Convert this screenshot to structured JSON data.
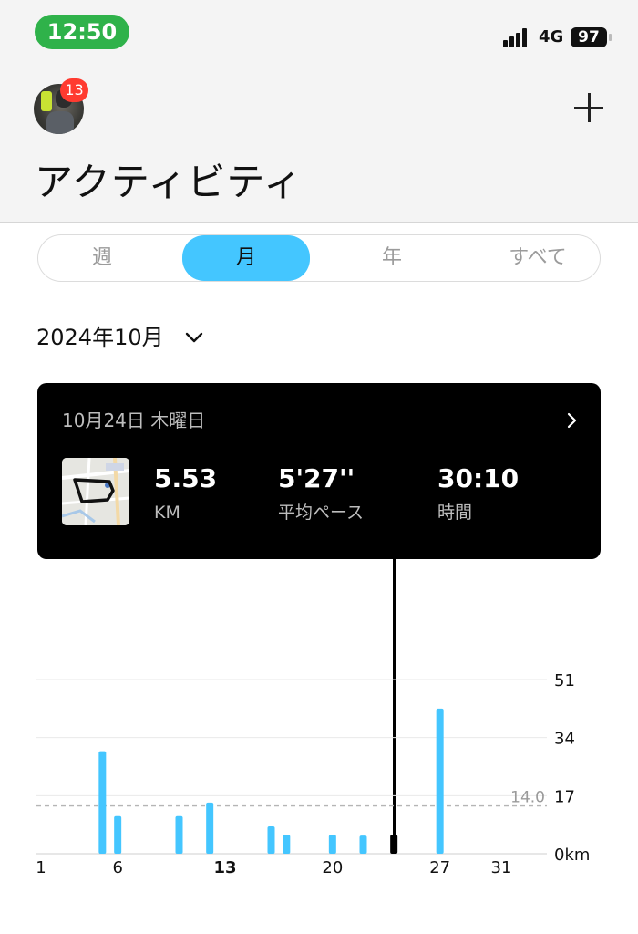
{
  "status_bar": {
    "time": "12:50",
    "network": "4G",
    "battery": "97"
  },
  "header": {
    "notification_count": "13",
    "title": "アクティビティ"
  },
  "segments": [
    "週",
    "月",
    "年",
    "すべて"
  ],
  "selected_segment": "月",
  "period": {
    "label": "2024年10月"
  },
  "activity_card": {
    "date": "10月24日 木曜日",
    "distance": {
      "value": "5.53",
      "label": "KM"
    },
    "pace": {
      "value": "5'27''",
      "label": "平均ペース"
    },
    "duration": {
      "value": "30:10",
      "label": "時間"
    }
  },
  "colors": {
    "accent": "#44c6ff",
    "card_bg": "#000000",
    "status_green": "#2fb24a",
    "badge_red": "#ff3b30"
  },
  "chart_data": {
    "type": "bar",
    "x_axis_range": [
      1,
      31
    ],
    "x_tick_labels": [
      "1",
      "6",
      "13",
      "20",
      "27",
      "31"
    ],
    "bold_tick": "13",
    "y_tick_labels": [
      "51",
      "34",
      "17",
      "0km"
    ],
    "ylim": [
      0,
      51
    ],
    "average_value": 14.0,
    "average_label": "14.0",
    "selected_day": 24,
    "series": [
      {
        "values": [
          {
            "day": 5,
            "km": 30.0
          },
          {
            "day": 6,
            "km": 11.0
          },
          {
            "day": 10,
            "km": 11.0
          },
          {
            "day": 12,
            "km": 15.0
          },
          {
            "day": 16,
            "km": 8.0
          },
          {
            "day": 17,
            "km": 5.5
          },
          {
            "day": 20,
            "km": 5.5
          },
          {
            "day": 22,
            "km": 5.3
          },
          {
            "day": 24,
            "km": 5.53
          },
          {
            "day": 27,
            "km": 42.5
          }
        ]
      }
    ]
  }
}
